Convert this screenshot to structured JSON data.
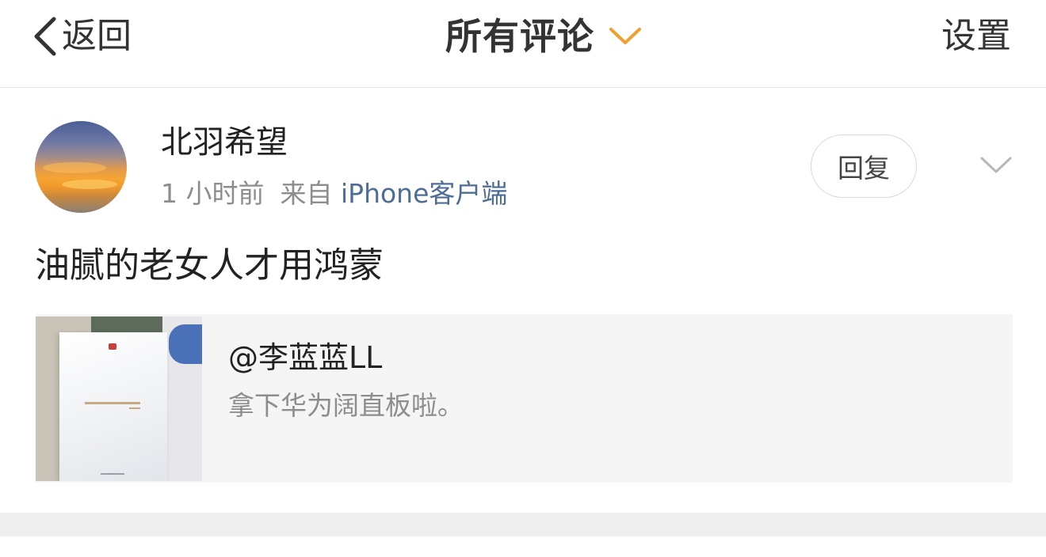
{
  "header": {
    "back_label": "返回",
    "title": "所有评论",
    "settings_label": "设置"
  },
  "comment": {
    "username": "北羽希望",
    "time": "1 小时前",
    "source_prefix": "来自",
    "source": "iPhone客户端",
    "reply_label": "回复",
    "text": "油腻的老女人才用鸿蒙"
  },
  "quoted_post": {
    "user": "@李蓝蓝LL",
    "text": "拿下华为阔直板啦。"
  },
  "colors": {
    "accent_chevron": "#f0a030",
    "source_link": "#4d6d95",
    "meta_gray": "#8d8d8d",
    "card_bg": "#f5f5f5"
  },
  "icons": {
    "back": "chevron-left-icon",
    "title_dropdown": "chevron-down-icon",
    "more": "chevron-down-icon"
  }
}
